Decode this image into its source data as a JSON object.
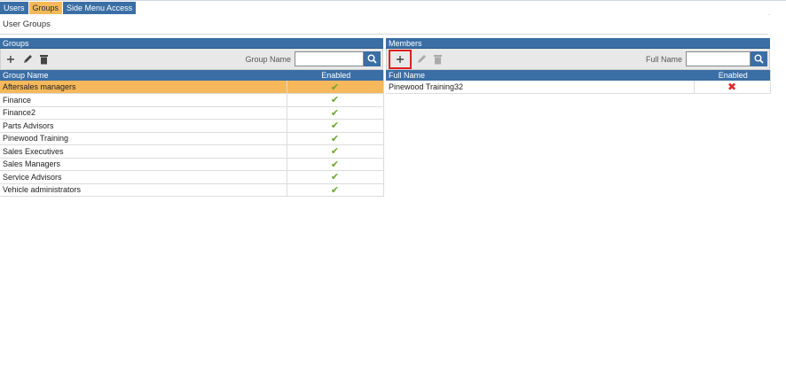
{
  "tabs": [
    {
      "label": "Users",
      "active": false
    },
    {
      "label": "Groups",
      "active": true
    },
    {
      "label": "Side Menu Access",
      "active": false
    }
  ],
  "page": {
    "title": "User Groups",
    "corner_mark": "."
  },
  "groups_panel": {
    "header": "Groups",
    "toolbar": {
      "add_icon": "plus-icon",
      "edit_icon": "pencil-icon",
      "delete_icon": "trash-icon"
    },
    "search": {
      "label": "Group Name",
      "value": "",
      "placeholder": ""
    },
    "columns": [
      "Group Name",
      "Enabled"
    ],
    "rows": [
      {
        "name": "Aftersales managers",
        "enabled": true,
        "selected": true
      },
      {
        "name": "Finance",
        "enabled": true,
        "selected": false
      },
      {
        "name": "Finance2",
        "enabled": true,
        "selected": false
      },
      {
        "name": "Parts Advisors",
        "enabled": true,
        "selected": false
      },
      {
        "name": "Pinewood Training",
        "enabled": true,
        "selected": false
      },
      {
        "name": "Sales Executives",
        "enabled": true,
        "selected": false
      },
      {
        "name": "Sales Managers",
        "enabled": true,
        "selected": false
      },
      {
        "name": "Service Advisors",
        "enabled": true,
        "selected": false
      },
      {
        "name": "Vehicle administrators",
        "enabled": true,
        "selected": false
      }
    ]
  },
  "members_panel": {
    "header": "Members",
    "toolbar": {
      "add_icon": "plus-icon",
      "edit_icon": "pencil-icon",
      "delete_icon": "trash-icon"
    },
    "search": {
      "label": "Full Name",
      "value": "",
      "placeholder": ""
    },
    "columns": [
      "Full Name",
      "Enabled"
    ],
    "rows": [
      {
        "name": "Pinewood Training32",
        "enabled": false
      }
    ]
  },
  "colors": {
    "header_blue": "#3a6ea5",
    "selected_orange": "#f5b85a",
    "check_green": "#6aa52a",
    "cross_red": "#e02a2a",
    "highlight_red": "#e02020"
  }
}
